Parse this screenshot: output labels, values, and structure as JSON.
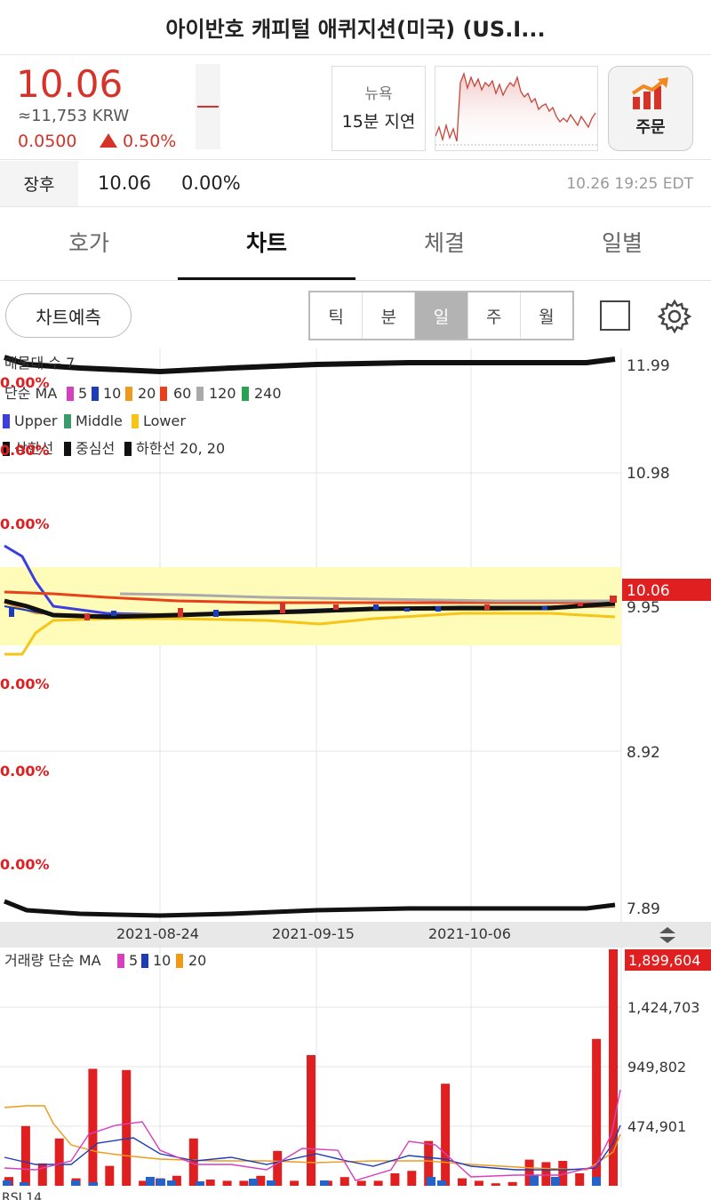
{
  "header": {
    "title": "아이반호 캐피털 애퀴지션(미국) (US.I..."
  },
  "quote": {
    "price": "10.06",
    "krw": "≈11,753 KRW",
    "change": "0.0500",
    "change_pct": "0.50%",
    "exchange": "뉴욕",
    "delay": "15분 지연",
    "order_label": "주문"
  },
  "after_hours": {
    "label": "장후",
    "price": "10.06",
    "pct": "0.00%",
    "time": "10.26 19:25 EDT"
  },
  "tabs": [
    {
      "label": "호가"
    },
    {
      "label": "차트"
    },
    {
      "label": "체결"
    },
    {
      "label": "일별"
    }
  ],
  "toolbar": {
    "predict_label": "차트예측",
    "periods": [
      "틱",
      "분",
      "일",
      "주",
      "월"
    ],
    "active_period": "일"
  },
  "chart": {
    "legend_title": "매물대 수 7",
    "ma_prefix": "단순 MA",
    "ma_legend": [
      {
        "label": "5",
        "color": "#d63fbe"
      },
      {
        "label": "10",
        "color": "#1d3db8"
      },
      {
        "label": "20",
        "color": "#f09a1a"
      },
      {
        "label": "60",
        "color": "#e8401a"
      },
      {
        "label": "120",
        "color": "#aaaaaa"
      },
      {
        "label": "240",
        "color": "#2aa050"
      }
    ],
    "bb_legend": [
      {
        "label": "Upper",
        "color": "#3b3fe0"
      },
      {
        "label": "Middle",
        "color": "#3a9a6a"
      },
      {
        "label": "Lower",
        "color": "#f5c518"
      }
    ],
    "env_legend": {
      "upper": "상한선",
      "middle": "중심선",
      "lower": "하한선 20, 20"
    },
    "volume_profile_pcts": [
      "0.00%",
      "0.00%",
      "0.00%",
      "0.00%",
      "0.00%",
      "0.00%"
    ],
    "current_price_tag": "10.06",
    "y_ticks": [
      "11.99",
      "10.98",
      "9.95",
      "8.92",
      "7.89"
    ],
    "dates": [
      "2021-08-24",
      "2021-09-15",
      "2021-10-06"
    ],
    "volume_prefix": "거래량 단순 MA",
    "volume_ma_legend": [
      {
        "label": "5",
        "color": "#d63fbe"
      },
      {
        "label": "10",
        "color": "#1d3db8"
      },
      {
        "label": "20",
        "color": "#f09a1a"
      }
    ],
    "volume_ticks": [
      "1,899,604",
      "1,424,703",
      "949,802",
      "474,901"
    ],
    "rsi_label": "RSI 14"
  },
  "chart_data": [
    {
      "type": "line",
      "name": "price",
      "ylim": [
        7.89,
        11.99
      ],
      "xlabel": "",
      "ylabel": "",
      "x": [
        "2021-08-24",
        "2021-09-15",
        "2021-10-06"
      ],
      "series": [
        {
          "name": "close",
          "values": [
            9.96,
            9.95,
            9.97,
            10.0,
            10.06
          ]
        }
      ],
      "last": 10.06
    },
    {
      "type": "bar",
      "name": "volume",
      "ylim": [
        0,
        1899604
      ],
      "values": [
        70000,
        480000,
        180000,
        380000,
        60000,
        940000,
        160000,
        930000,
        40000,
        60000,
        80000,
        380000,
        50000,
        40000,
        40000,
        80000,
        280000,
        40000,
        1050000,
        40000,
        70000,
        40000,
        40000,
        100000,
        120000,
        360000,
        820000,
        60000,
        40000,
        20000,
        30000,
        210000,
        190000,
        200000,
        100000,
        1180000,
        1899604
      ]
    }
  ]
}
